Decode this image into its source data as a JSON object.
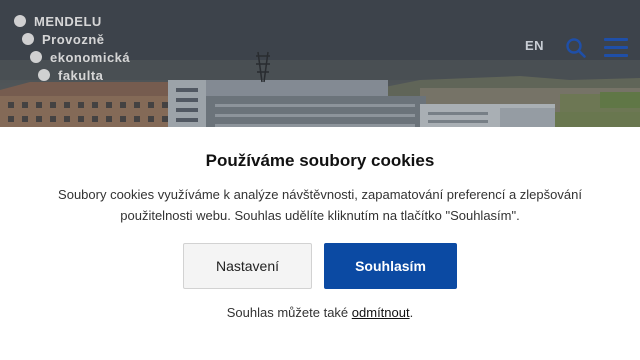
{
  "logo": {
    "lines": [
      "MENDELU",
      "Provozně",
      "ekonomická",
      "fakulta"
    ]
  },
  "header": {
    "language": "EN",
    "search_icon": "search-icon",
    "menu_icon": "hamburger-menu-icon"
  },
  "cookie_banner": {
    "title": "Používáme soubory cookies",
    "text": "Soubory cookies využíváme k analýze návštěvnosti, zapamatování preferencí a zlepšování použitelnosti webu. Souhlas udělíte kliknutím na tlačítko \"Souhlasím\".",
    "settings_label": "Nastavení",
    "accept_label": "Souhlasím",
    "footer_prefix": "Souhlas můžete také ",
    "reject_link": "odmítnout",
    "footer_suffix": "."
  },
  "colors": {
    "brand_blue": "#0b4aa3",
    "icon_blue": "#1f4fa8"
  }
}
